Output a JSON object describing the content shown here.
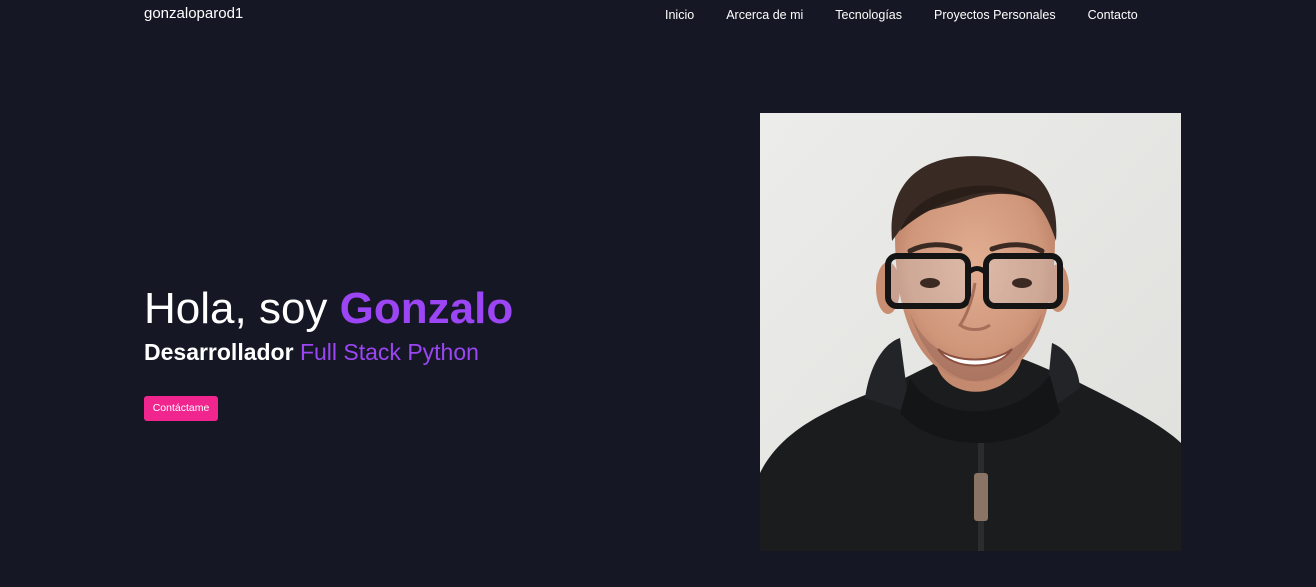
{
  "navbar": {
    "brand": "gonzaloparod1",
    "links": [
      "Inicio",
      "Arcerca de mi",
      "Tecnologías",
      "Proyectos Personales",
      "Contacto"
    ]
  },
  "hero": {
    "greeting": "Hola, soy ",
    "name": "Gonzalo",
    "subtitle_prefix": "Desarrollador ",
    "subtitle_role": "Full Stack Python",
    "cta_label": "Contáctame"
  },
  "colors": {
    "background": "#151824",
    "accent_purple": "#9b45f5",
    "button_pink": "#f0258d"
  },
  "photo": {
    "subject": "portrait-photo"
  }
}
